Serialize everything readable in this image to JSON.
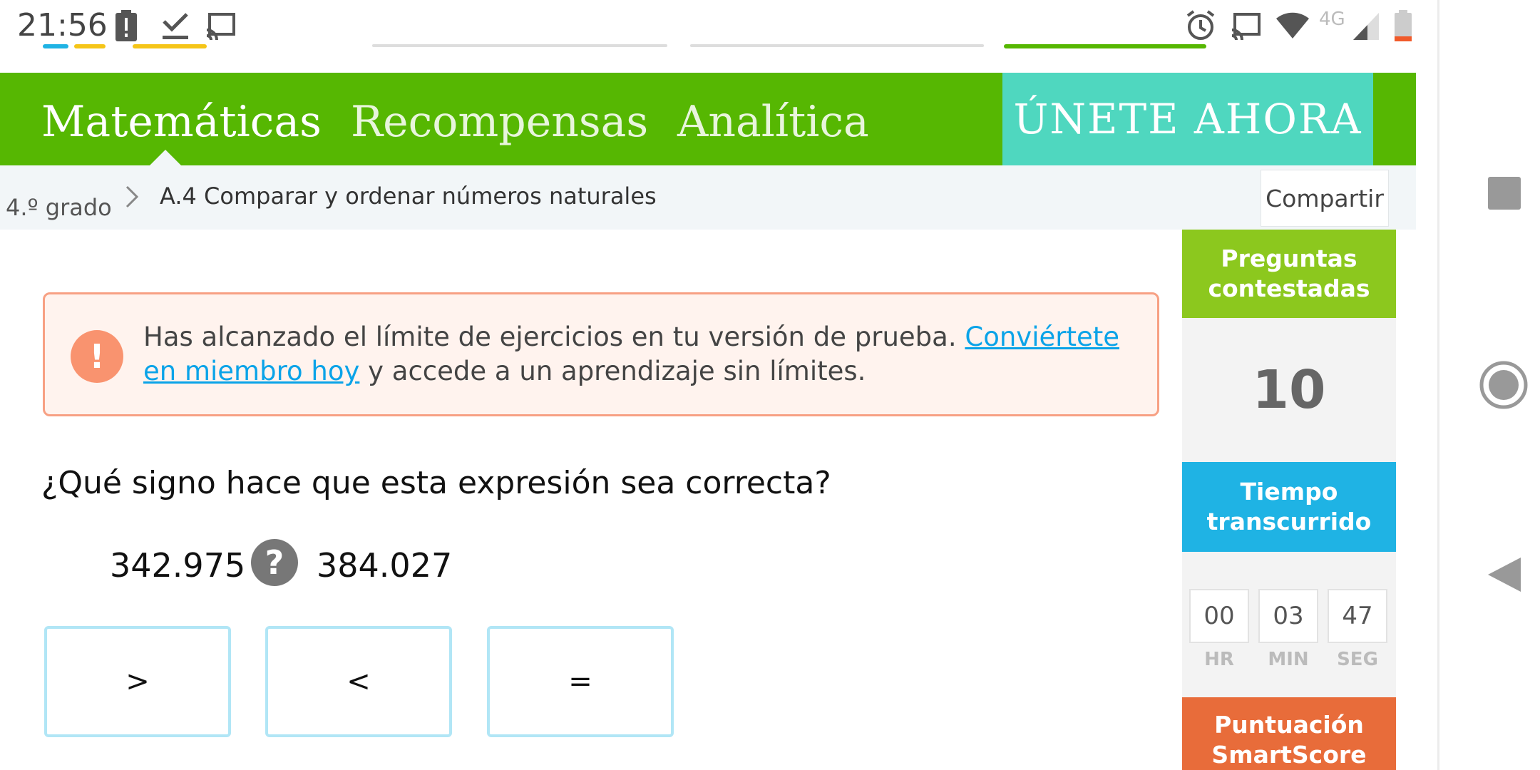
{
  "status_bar": {
    "time": "21:56",
    "network": "4G",
    "left_icons": [
      "battery-alert-icon",
      "download-done-icon",
      "cast-icon"
    ],
    "right_icons": [
      "alarm-icon",
      "cast-icon",
      "wifi-icon",
      "signal-icon",
      "battery-low-icon"
    ]
  },
  "nav": {
    "items": [
      {
        "label": "Matemáticas",
        "active": true
      },
      {
        "label": "Recompensas",
        "active": false
      },
      {
        "label": "Analítica",
        "active": false
      }
    ],
    "join_label": "ÚNETE AHORA",
    "color": "#56b702",
    "join_color": "#4fd7bf"
  },
  "breadcrumb": {
    "grade": "4.º grado",
    "skill": "A.4 Comparar y ordenar números naturales",
    "share_label": "Compartir"
  },
  "alert": {
    "text_before": "Has alcanzado el límite de ejercicios en tu versión de prueba. ",
    "link_text": "Conviértete en miembro hoy",
    "text_after": " y accede a un aprendizaje sin límites."
  },
  "question": {
    "prompt": "¿Qué signo hace que esta expresión sea correcta?",
    "left_number": "342.975",
    "right_number": "384.027",
    "unknown_symbol": "?",
    "options": [
      ">",
      "<",
      "="
    ]
  },
  "sidebar": {
    "answered_label": "Preguntas contestadas",
    "answered_value": "10",
    "time_label": "Tiempo transcurrido",
    "time": {
      "hr": "00",
      "min": "03",
      "seg": "47"
    },
    "time_units": {
      "hr": "HR",
      "min": "MIN",
      "seg": "SEG"
    },
    "score_label": "Puntuación SmartScore",
    "colors": {
      "answered": "#8cc81e",
      "time": "#1fb3e4",
      "score": "#e86c3a"
    }
  },
  "android_nav": [
    "recents-icon",
    "home-icon",
    "back-icon"
  ]
}
